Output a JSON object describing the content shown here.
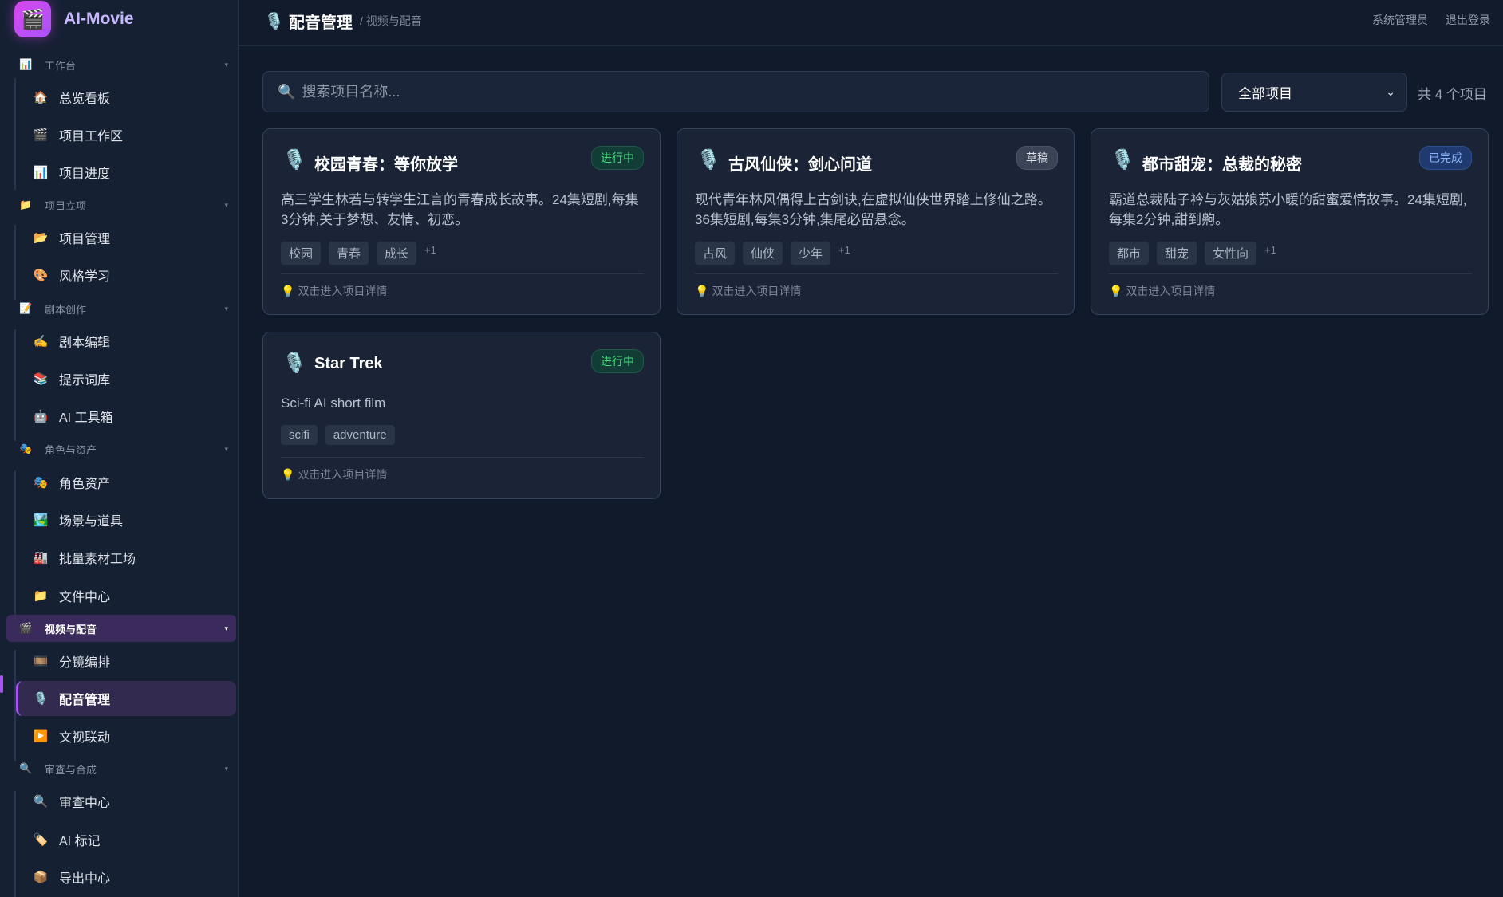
{
  "brand": {
    "logo_icon": "🎬",
    "name": "AI-Movie"
  },
  "sidebar": {
    "groups": [
      {
        "icon": "📊",
        "label": "工作台"
      },
      {
        "icon": "📁",
        "label": "项目立项"
      },
      {
        "icon": "📝",
        "label": "剧本创作"
      },
      {
        "icon": "🎭",
        "label": "角色与资产"
      },
      {
        "icon": "🎬",
        "label": "视频与配音"
      },
      {
        "icon": "🔍",
        "label": "审查与合成"
      }
    ],
    "items": [
      {
        "icon": "🏠",
        "label": "总览看板"
      },
      {
        "icon": "🎬",
        "label": "项目工作区"
      },
      {
        "icon": "📊",
        "label": "项目进度"
      },
      {
        "icon": "📂",
        "label": "项目管理"
      },
      {
        "icon": "🎨",
        "label": "风格学习"
      },
      {
        "icon": "✍️",
        "label": "剧本编辑"
      },
      {
        "icon": "📚",
        "label": "提示词库"
      },
      {
        "icon": "🤖",
        "label": "AI 工具箱"
      },
      {
        "icon": "🎭",
        "label": "角色资产"
      },
      {
        "icon": "🏞️",
        "label": "场景与道具"
      },
      {
        "icon": "🏭",
        "label": "批量素材工场"
      },
      {
        "icon": "📁",
        "label": "文件中心"
      },
      {
        "icon": "🎞️",
        "label": "分镜编排"
      },
      {
        "icon": "🎙️",
        "label": "配音管理"
      },
      {
        "icon": "▶️",
        "label": "文视联动"
      },
      {
        "icon": "🔍",
        "label": "审查中心"
      },
      {
        "icon": "🏷️",
        "label": "AI 标记"
      },
      {
        "icon": "📦",
        "label": "导出中心"
      }
    ],
    "chevron": "▾"
  },
  "header": {
    "icon": "🎙️",
    "title": "配音管理",
    "breadcrumb": "/ 视频与配音",
    "user": "系统管理员",
    "logout": "退出登录"
  },
  "toolbar": {
    "search_icon": "🔍",
    "search_placeholder": "搜索项目名称...",
    "filter_value": "全部项目",
    "filter_caret": "⌄",
    "count_text": "共 4 个项目"
  },
  "projects": [
    {
      "icon": "🎙️",
      "title": "校园青春：等你放学",
      "status": "进行中",
      "status_color": "#4ade80",
      "description": "高三学生林若与转学生江言的青春成长故事。24集短剧,每集3分钟,关于梦想、友情、初恋。",
      "tags": [
        "校园",
        "青春",
        "成长"
      ],
      "more": "+1",
      "hint_icon": "💡",
      "hint": "双击进入项目详情"
    },
    {
      "icon": "🎙️",
      "title": "古风仙侠：剑心问道",
      "status": "草稿",
      "status_color": "#dfe3ea",
      "description": "现代青年林风偶得上古剑诀,在虚拟仙侠世界踏上修仙之路。36集短剧,每集3分钟,集尾必留悬念。",
      "tags": [
        "古风",
        "仙侠",
        "少年"
      ],
      "more": "+1",
      "hint_icon": "💡",
      "hint": "双击进入项目详情"
    },
    {
      "icon": "🎙️",
      "title": "都市甜宠：总裁的秘密",
      "status": "已完成",
      "status_color": "#8ab4ff",
      "description": "霸道总裁陆子衿与灰姑娘苏小暖的甜蜜爱情故事。24集短剧,每集2分钟,甜到齁。",
      "tags": [
        "都市",
        "甜宠",
        "女性向"
      ],
      "more": "+1",
      "hint_icon": "💡",
      "hint": "双击进入项目详情"
    },
    {
      "icon": "🎙️",
      "title": "Star Trek",
      "status": "进行中",
      "status_color": "#4ade80",
      "description": "Sci-fi AI short film",
      "tags": [
        "scifi",
        "adventure"
      ],
      "more": "",
      "hint_icon": "💡",
      "hint": "双击进入项目详情"
    }
  ]
}
